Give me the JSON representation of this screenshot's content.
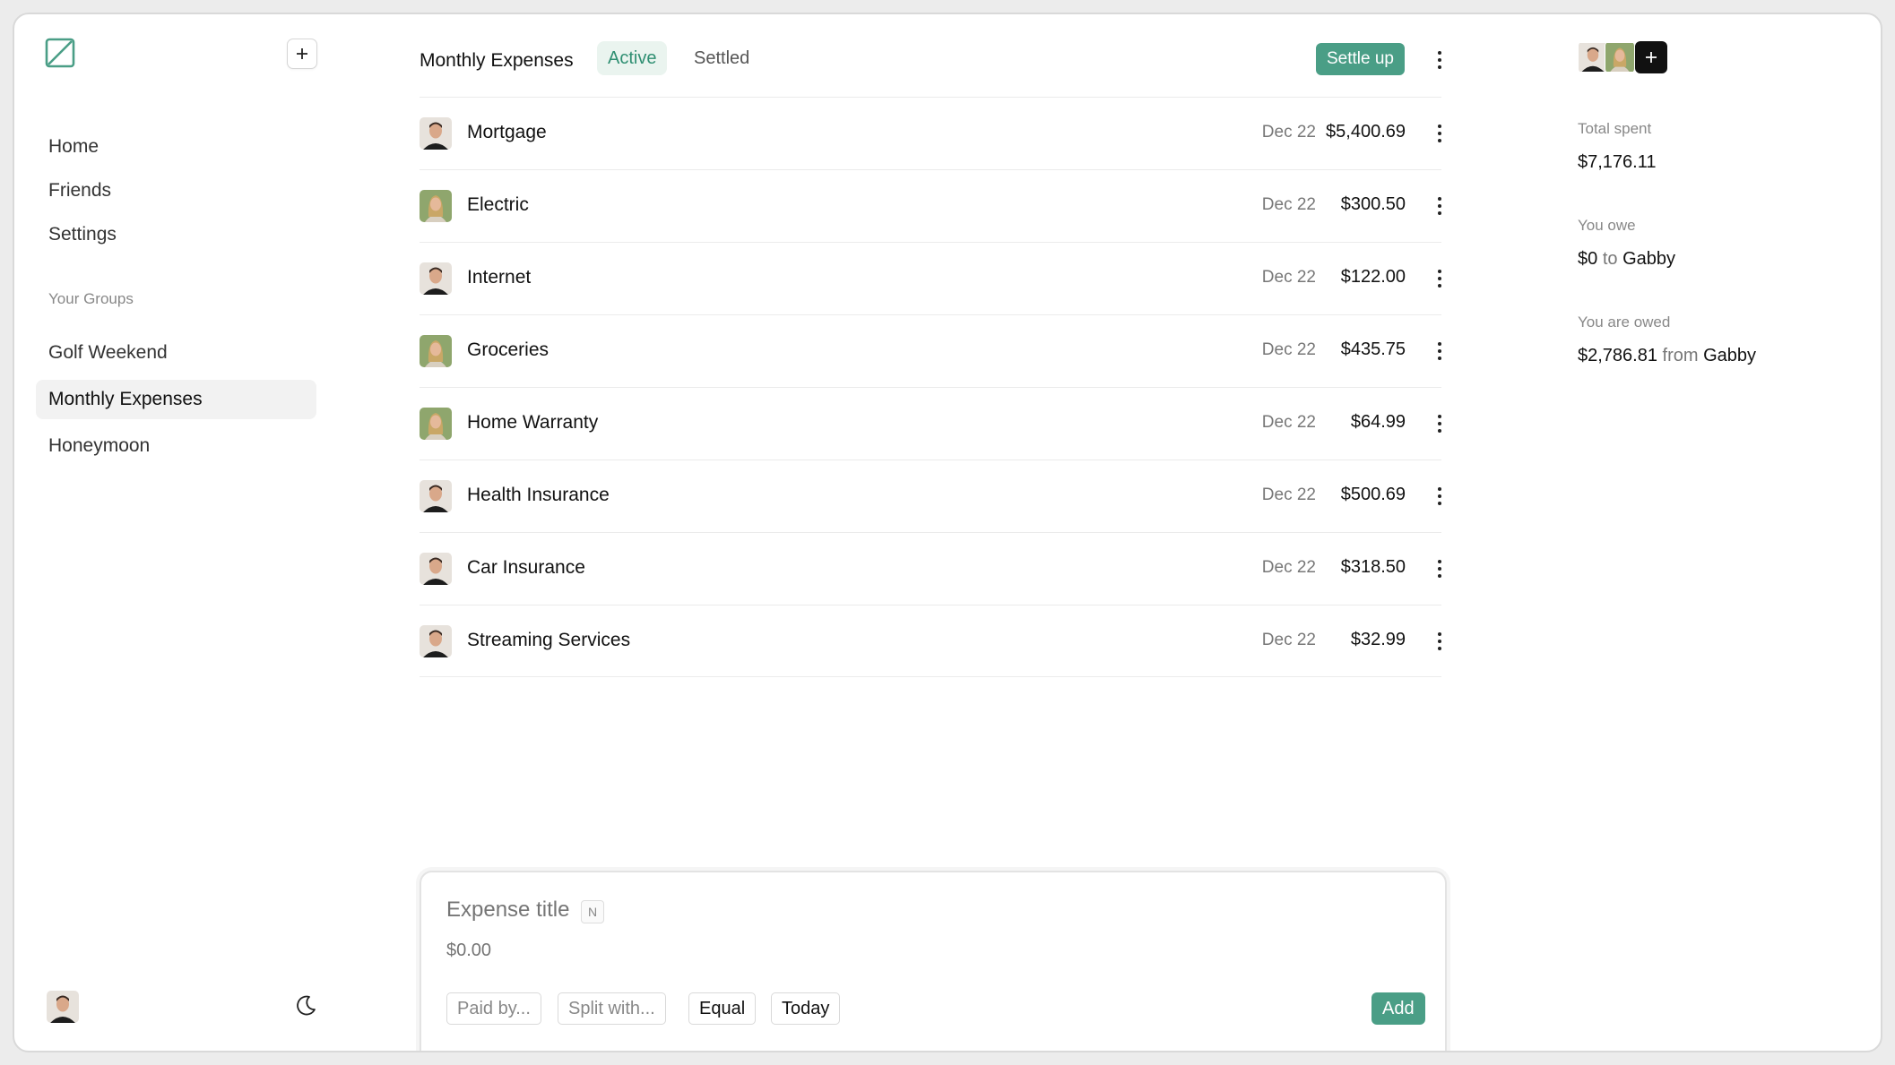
{
  "sidebar": {
    "nav": [
      "Home",
      "Friends",
      "Settings"
    ],
    "groups_heading": "Your Groups",
    "groups": [
      "Golf Weekend",
      "Monthly Expenses",
      "Honeymoon"
    ],
    "active_group": "Monthly Expenses"
  },
  "header": {
    "title": "Monthly Expenses",
    "tab_active": "Active",
    "tab_settled": "Settled",
    "settle_label": "Settle up"
  },
  "expenses": [
    {
      "title": "Mortgage",
      "date": "Dec 22",
      "amount": "$5,400.69",
      "payer": "man"
    },
    {
      "title": "Electric",
      "date": "Dec 22",
      "amount": "$300.50",
      "payer": "woman"
    },
    {
      "title": "Internet",
      "date": "Dec 22",
      "amount": "$122.00",
      "payer": "man"
    },
    {
      "title": "Groceries",
      "date": "Dec 22",
      "amount": "$435.75",
      "payer": "woman"
    },
    {
      "title": "Home Warranty",
      "date": "Dec 22",
      "amount": "$64.99",
      "payer": "woman"
    },
    {
      "title": "Health Insurance",
      "date": "Dec 22",
      "amount": "$500.69",
      "payer": "man"
    },
    {
      "title": "Car Insurance",
      "date": "Dec 22",
      "amount": "$318.50",
      "payer": "man"
    },
    {
      "title": "Streaming Services",
      "date": "Dec 22",
      "amount": "$32.99",
      "payer": "man"
    }
  ],
  "composer": {
    "title_placeholder": "Expense title",
    "shortcut": "N",
    "amount_placeholder": "$0.00",
    "paid_by": "Paid by...",
    "split_with": "Split with...",
    "split_mode": "Equal",
    "date": "Today",
    "add_label": "Add"
  },
  "summary": {
    "total_label": "Total spent",
    "total_value": "$7,176.11",
    "owe_label": "You owe",
    "owe_amount": "$0",
    "owe_connector": "to",
    "owe_person": "Gabby",
    "owed_label": "You are owed",
    "owed_amount": "$2,786.81",
    "owed_connector": "from",
    "owed_person": "Gabby"
  },
  "colors": {
    "accent": "#4a9e86",
    "accent_soft": "#eaf4ef",
    "accent_text": "#2f8f72"
  },
  "icons": [
    "logo-icon",
    "plus-icon",
    "moon-icon",
    "more-vertical-icon"
  ]
}
